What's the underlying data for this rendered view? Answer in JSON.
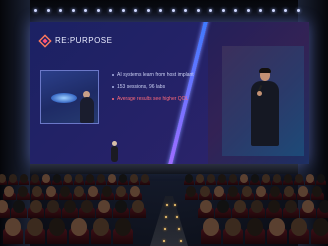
{
  "slide": {
    "brand": "RE:PURPOSE",
    "tagline": "",
    "bullets": [
      {
        "text": "AI systems learn from host implant",
        "highlight": false
      },
      {
        "text": "153 sessions, 96 labs",
        "highlight": false
      },
      {
        "text": "Average results see higher QOL",
        "highlight": true
      }
    ],
    "colors": {
      "accent": "#ff6b7a",
      "background": "#1b2163",
      "divider": "#3a7bff"
    }
  },
  "icons": {
    "logo": "diamond-logo-icon"
  }
}
